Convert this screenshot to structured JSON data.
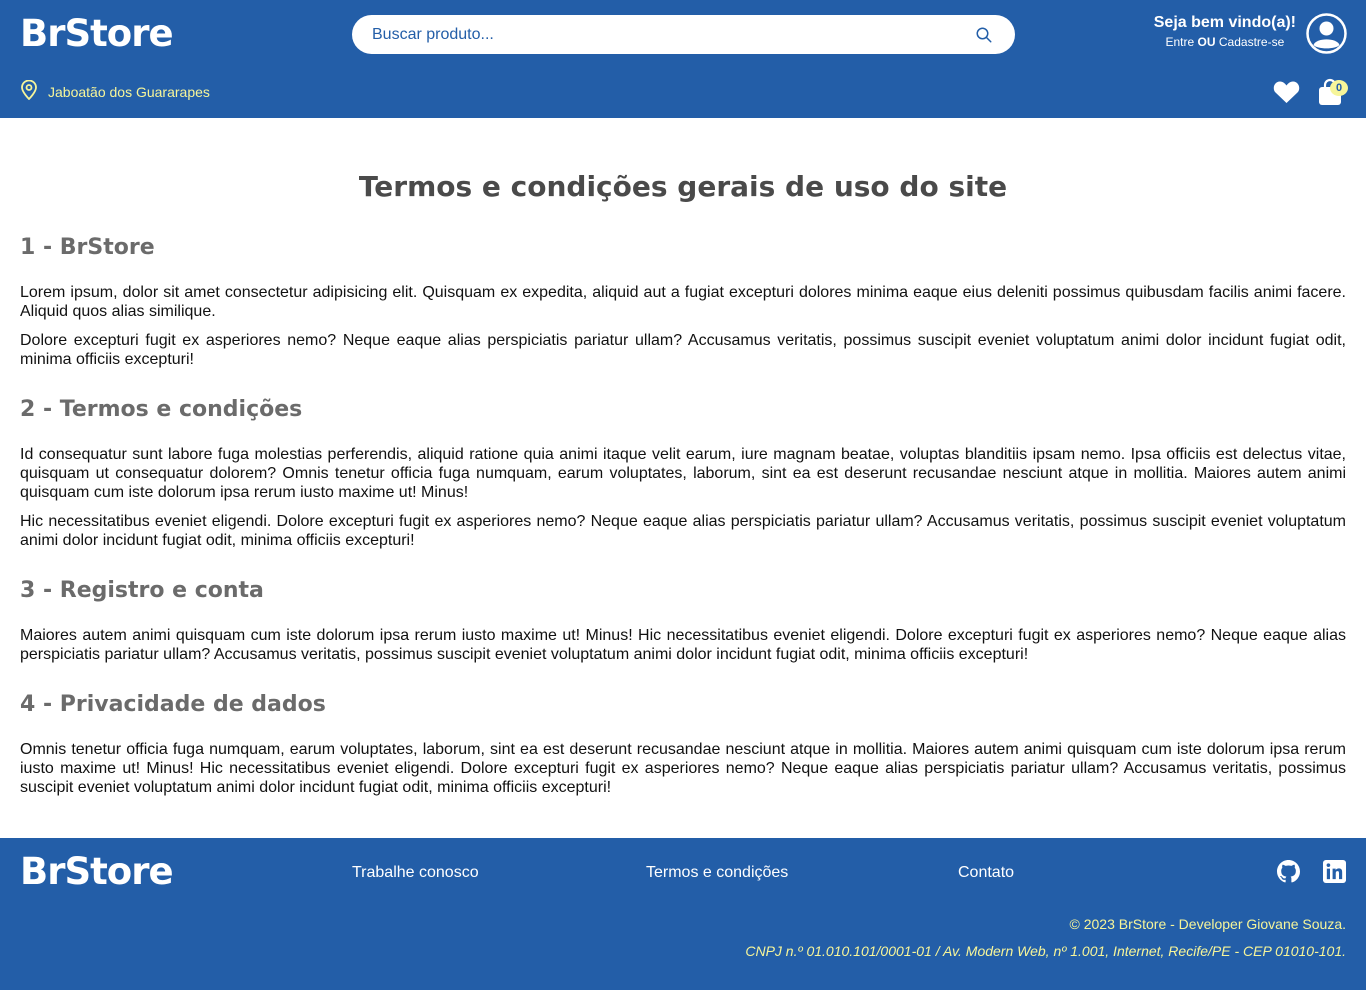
{
  "header": {
    "logo": "BrStore",
    "search_placeholder": "Buscar produto...",
    "welcome": "Seja bem vindo(a)!",
    "auth_enter": "Entre",
    "auth_or": "OU",
    "auth_signup": "Cadastre-se",
    "location": "Jaboatão dos Guararapes",
    "cart_count": "0"
  },
  "main": {
    "title": "Termos e condições gerais de uso do site",
    "sections": [
      {
        "heading": "1 - BrStore",
        "paragraphs": [
          "Lorem ipsum, dolor sit amet consectetur adipisicing elit. Quisquam ex expedita, aliquid aut a fugiat excepturi dolores minima eaque eius deleniti possimus quibusdam facilis animi facere. Aliquid quos alias similique.",
          "Dolore excepturi fugit ex asperiores nemo? Neque eaque alias perspiciatis pariatur ullam? Accusamus veritatis, possimus suscipit eveniet voluptatum animi dolor incidunt fugiat odit, minima officiis excepturi!"
        ]
      },
      {
        "heading": "2 - Termos e condições",
        "paragraphs": [
          "Id consequatur sunt labore fuga molestias perferendis, aliquid ratione quia animi itaque velit earum, iure magnam beatae, voluptas blanditiis ipsam nemo. Ipsa officiis est delectus vitae, quisquam ut consequatur dolorem? Omnis tenetur officia fuga numquam, earum voluptates, laborum, sint ea est deserunt recusandae nesciunt atque in mollitia. Maiores autem animi quisquam cum iste dolorum ipsa rerum iusto maxime ut! Minus!",
          "Hic necessitatibus eveniet eligendi. Dolore excepturi fugit ex asperiores nemo? Neque eaque alias perspiciatis pariatur ullam? Accusamus veritatis, possimus suscipit eveniet voluptatum animi dolor incidunt fugiat odit, minima officiis excepturi!"
        ]
      },
      {
        "heading": "3 - Registro e conta",
        "paragraphs": [
          "Maiores autem animi quisquam cum iste dolorum ipsa rerum iusto maxime ut! Minus! Hic necessitatibus eveniet eligendi. Dolore excepturi fugit ex asperiores nemo? Neque eaque alias perspiciatis pariatur ullam? Accusamus veritatis, possimus suscipit eveniet voluptatum animi dolor incidunt fugiat odit, minima officiis excepturi!"
        ]
      },
      {
        "heading": "4 - Privacidade de dados",
        "paragraphs": [
          "Omnis tenetur officia fuga numquam, earum voluptates, laborum, sint ea est deserunt recusandae nesciunt atque in mollitia. Maiores autem animi quisquam cum iste dolorum ipsa rerum iusto maxime ut! Minus! Hic necessitatibus eveniet eligendi. Dolore excepturi fugit ex asperiores nemo? Neque eaque alias perspiciatis pariatur ullam? Accusamus veritatis, possimus suscipit eveniet voluptatum animi dolor incidunt fugiat odit, minima officiis excepturi!"
        ]
      }
    ]
  },
  "footer": {
    "logo": "BrStore",
    "links": [
      "Trabalhe conosco",
      "Termos e condições",
      "Contato"
    ],
    "copyright": "© 2023 BrStore - Developer Giovane Souza.",
    "cnpj": "CNPJ n.º 01.010.101/0001-01 / Av. Modern Web, nº 1.001, Internet, Recife/PE - CEP 01010-101."
  },
  "icons": {
    "search": "search-icon",
    "user": "user-circle-icon",
    "location": "map-pin-icon",
    "favorite": "heart-icon",
    "cart": "shopping-bag-icon",
    "github": "github-icon",
    "linkedin": "linkedin-icon"
  },
  "colors": {
    "brand_blue": "#235ea8",
    "accent_yellow": "#f6f59a",
    "title_gray": "#4a4a4a",
    "heading_gray": "#6b6b6b"
  }
}
